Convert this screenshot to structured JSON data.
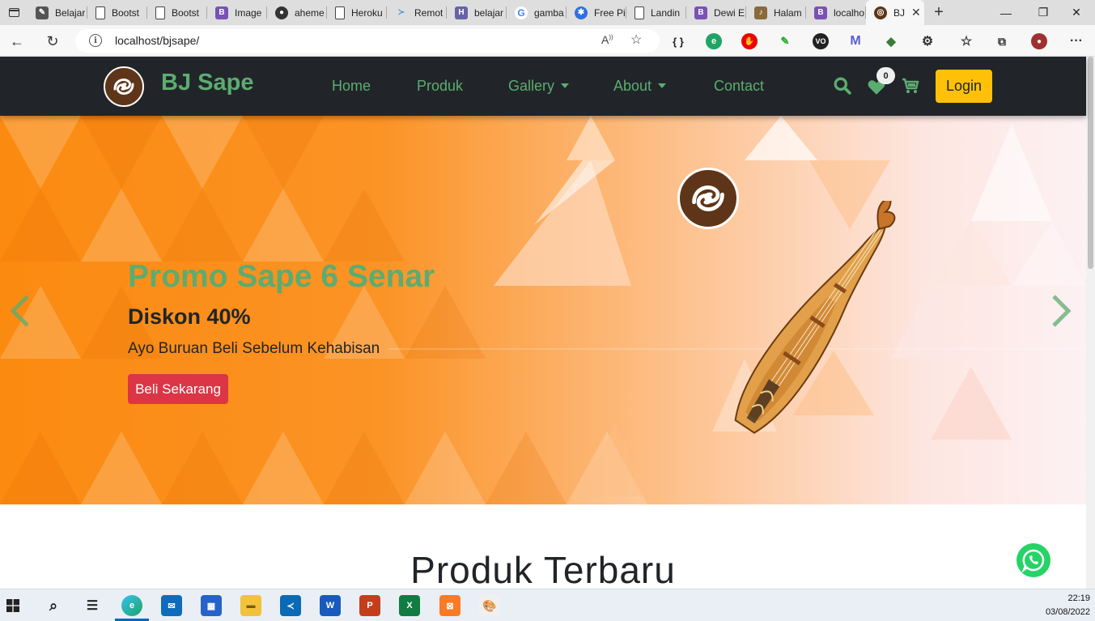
{
  "browser": {
    "tabs": [
      {
        "title": "Belajar",
        "icon": "pen-icon",
        "color": "#555555"
      },
      {
        "title": "Bootst",
        "icon": "page-icon",
        "color": "#ffffff"
      },
      {
        "title": "Bootst",
        "icon": "page-icon",
        "color": "#ffffff"
      },
      {
        "title": "Image",
        "icon": "bootstrap-icon",
        "color": "#7952b3"
      },
      {
        "title": "aheme",
        "icon": "github-icon",
        "color": "#333333"
      },
      {
        "title": "Heroku",
        "icon": "page-icon",
        "color": "#ffffff"
      },
      {
        "title": "Remot",
        "icon": "remote-icon",
        "color": "#4a90d9"
      },
      {
        "title": "belajar",
        "icon": "heroku-icon",
        "color": "#6762a6"
      },
      {
        "title": "gamba",
        "icon": "google-icon",
        "color": "#ffffff"
      },
      {
        "title": "Free Pi",
        "icon": "cloud-icon",
        "color": "#2f6fe0"
      },
      {
        "title": "Landin",
        "icon": "page-icon",
        "color": "#ffffff"
      },
      {
        "title": "Dewi E",
        "icon": "bootstrap-icon",
        "color": "#7952b3"
      },
      {
        "title": "Halam",
        "icon": "sape-icon",
        "color": "#8a6a3a"
      },
      {
        "title": "localho",
        "icon": "bootstrap-icon",
        "color": "#7952b3"
      }
    ],
    "active_tab": {
      "title": "BJ",
      "icon": "sape-logo-icon"
    },
    "url": "localhost/bjsape/"
  },
  "site": {
    "brand": "BJ Sape",
    "nav": {
      "home": "Home",
      "produk": "Produk",
      "gallery": "Gallery",
      "about": "About",
      "contact": "Contact"
    },
    "wishlist_count": "0",
    "login_label": "Login",
    "colors": {
      "primary": "#5cac70",
      "navbar": "#212529",
      "login": "#ffc107",
      "cta": "#dc3545"
    }
  },
  "hero": {
    "title": "Promo Sape 6 Senar",
    "subtitle": "Diskon 40%",
    "description": "Ayo Buruan Beli Sebelum Kehabisan",
    "button": "Beli Sekarang"
  },
  "section": {
    "title": "Produk Terbaru"
  },
  "taskbar": {
    "time": "22:19",
    "date": "03/08/2022"
  }
}
